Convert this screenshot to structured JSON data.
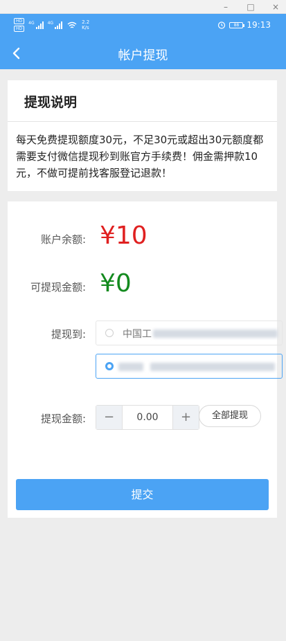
{
  "window_controls": {
    "minimize": "–",
    "maximize": "□",
    "close": "×"
  },
  "status_bar": {
    "sim1": "HD",
    "sim2": "HD",
    "signal1_label": "4G",
    "signal2_label": "4G",
    "net_speed_value": "2.2",
    "net_speed_unit": "K/s",
    "battery": "88",
    "time": "19:13",
    "icons": [
      "signal-icon",
      "wifi-icon",
      "alarm-icon",
      "battery-icon"
    ]
  },
  "nav": {
    "title": "帐户提现",
    "back_icon": "chevron-left-icon"
  },
  "notice": {
    "title": "提现说明",
    "body": "每天免费提现额度30元，不足30元或超出30元额度都需要支付微信提现秒到账官方手续费！佣金需押款10元，不做可提前找客服登记退款！"
  },
  "balance": {
    "label": "账户余额:",
    "value": "¥10",
    "color": "#e02020"
  },
  "withdrawable": {
    "label": "可提现金额:",
    "value": "¥0",
    "color": "#138a1e"
  },
  "withdraw_to": {
    "label": "提现到:",
    "options": [
      {
        "name": "中国工",
        "selected": false
      },
      {
        "name": "",
        "selected": true
      }
    ]
  },
  "amount": {
    "label": "提现金额:",
    "minus": "−",
    "value": "0.00",
    "plus": "+",
    "all_button": "全部提现"
  },
  "submit": {
    "label": "提交"
  },
  "colors": {
    "accent": "#4ba3f4",
    "background": "#ededed"
  }
}
